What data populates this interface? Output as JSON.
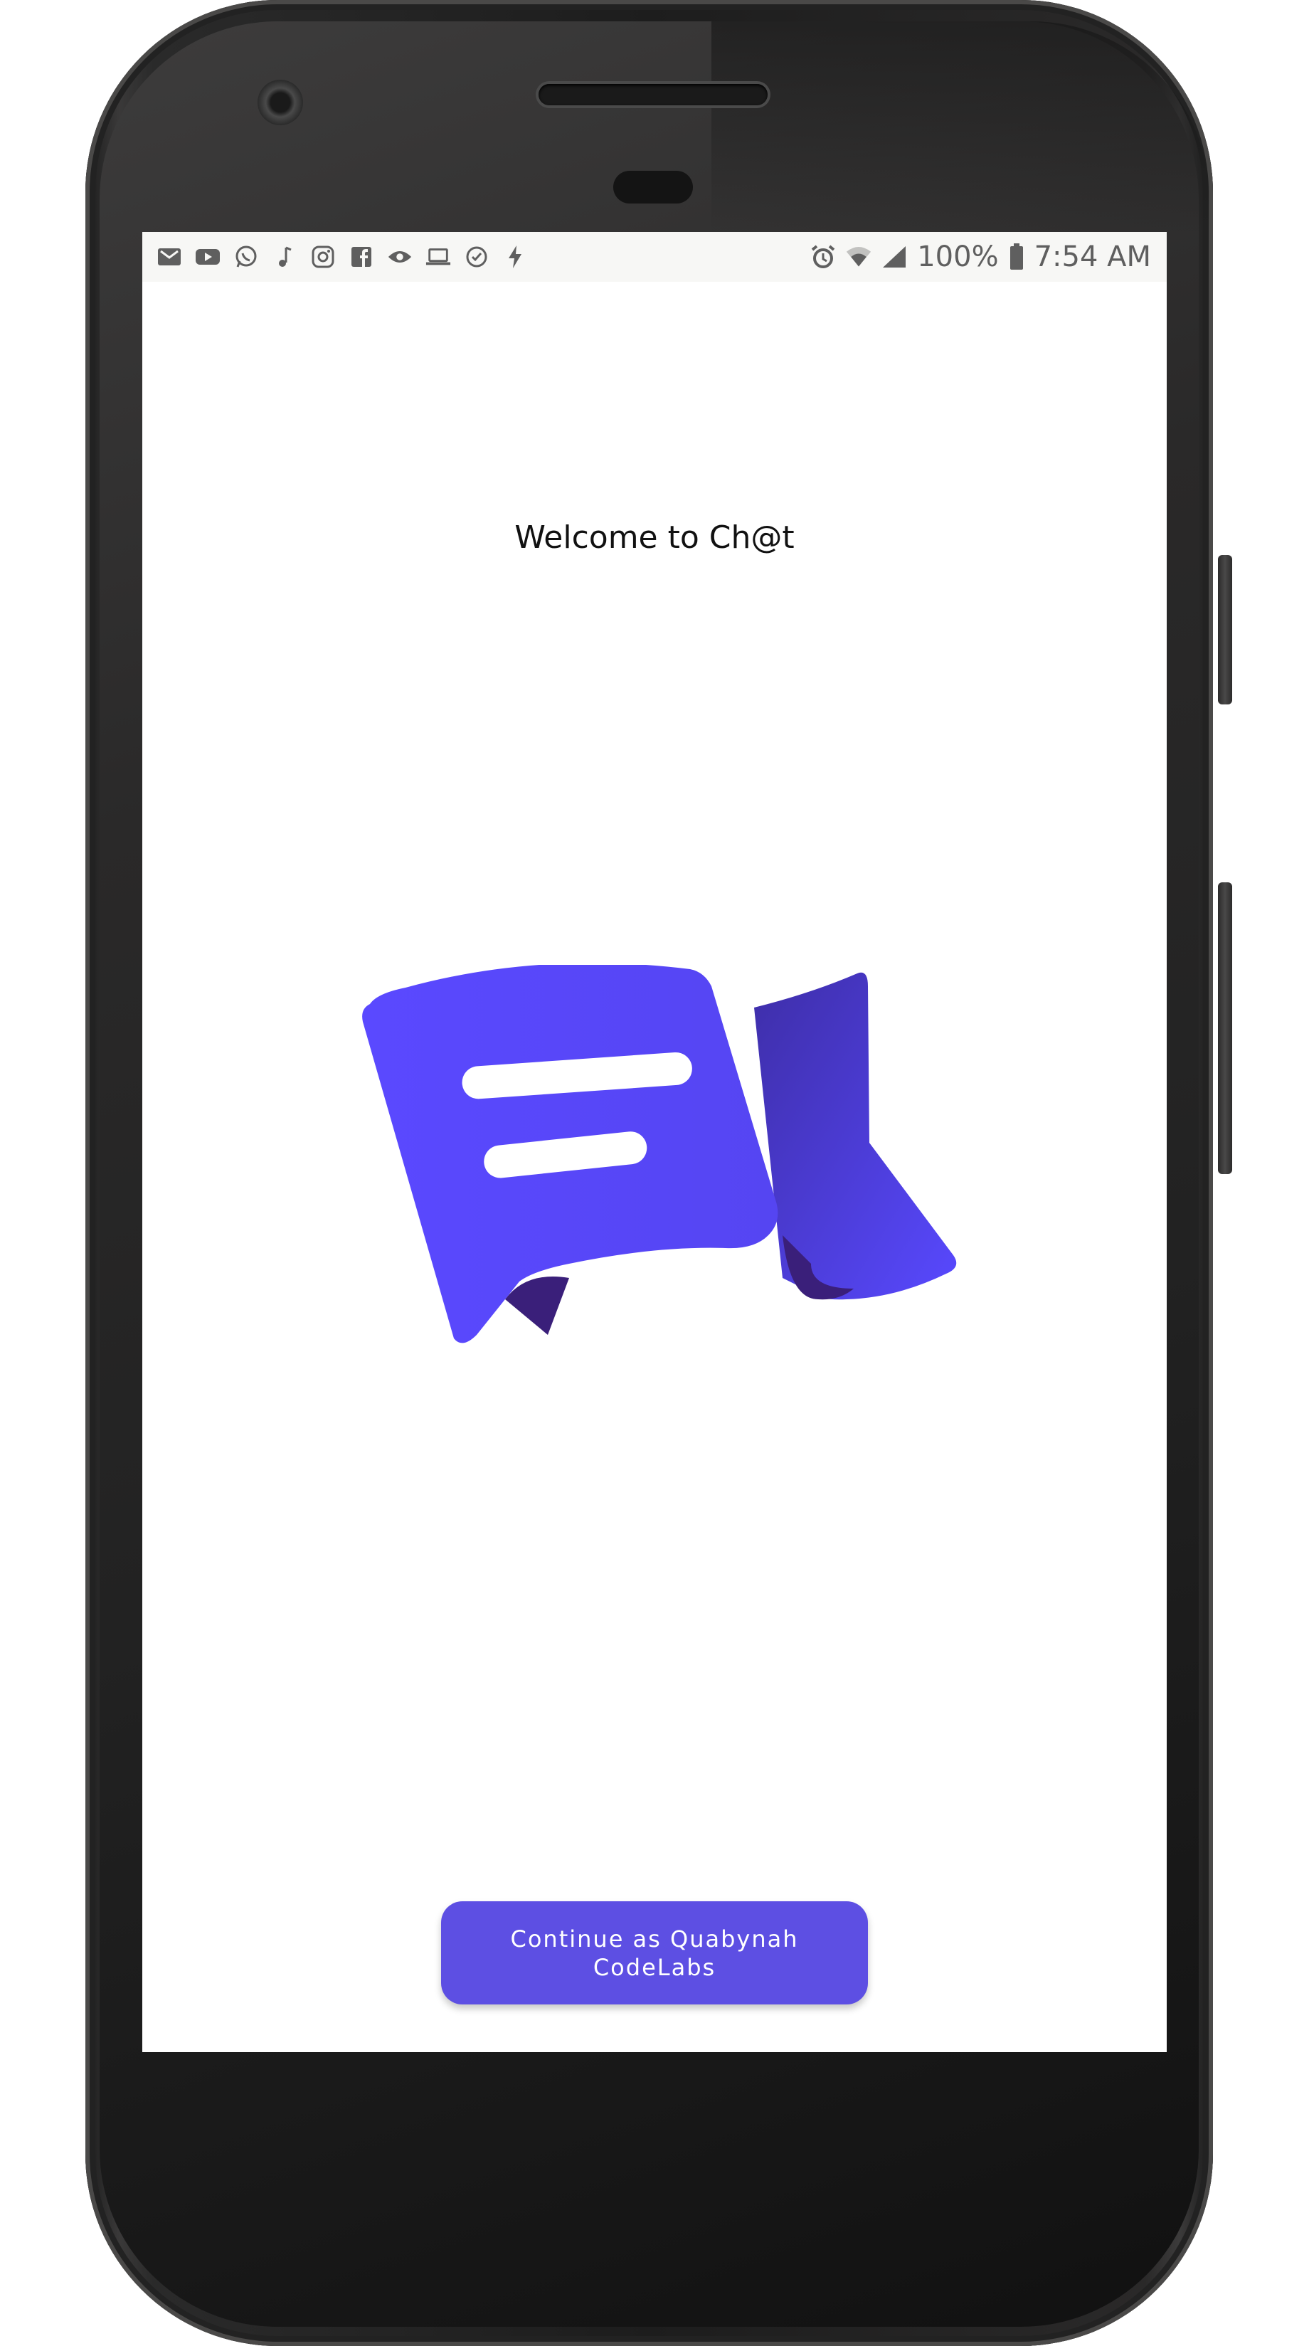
{
  "status_bar": {
    "notification_icons": [
      "gmail-icon",
      "youtube-icon",
      "whatsapp-icon",
      "music-note-icon",
      "instagram-icon",
      "facebook-icon",
      "eye-icon",
      "laptop-icon",
      "check-circle-icon",
      "lightning-icon"
    ],
    "alarm_icon": "alarm-icon",
    "wifi_icon": "wifi-icon",
    "signal_icon": "signal-icon",
    "battery_percent": "100%",
    "battery_icon": "battery-icon",
    "time": "7:54 AM"
  },
  "main": {
    "title": "Welcome to Ch@t",
    "logo_icon": "chat-flag-logo-icon",
    "continue_button_label": "Continue as Quabynah CodeLabs"
  },
  "colors": {
    "accent": "#5d4fe3",
    "logo_primary": "#5849ff",
    "logo_shadow": "#3c2a8a",
    "status_bar_bg": "#f7f7f5",
    "status_text": "#5f5f5f"
  }
}
